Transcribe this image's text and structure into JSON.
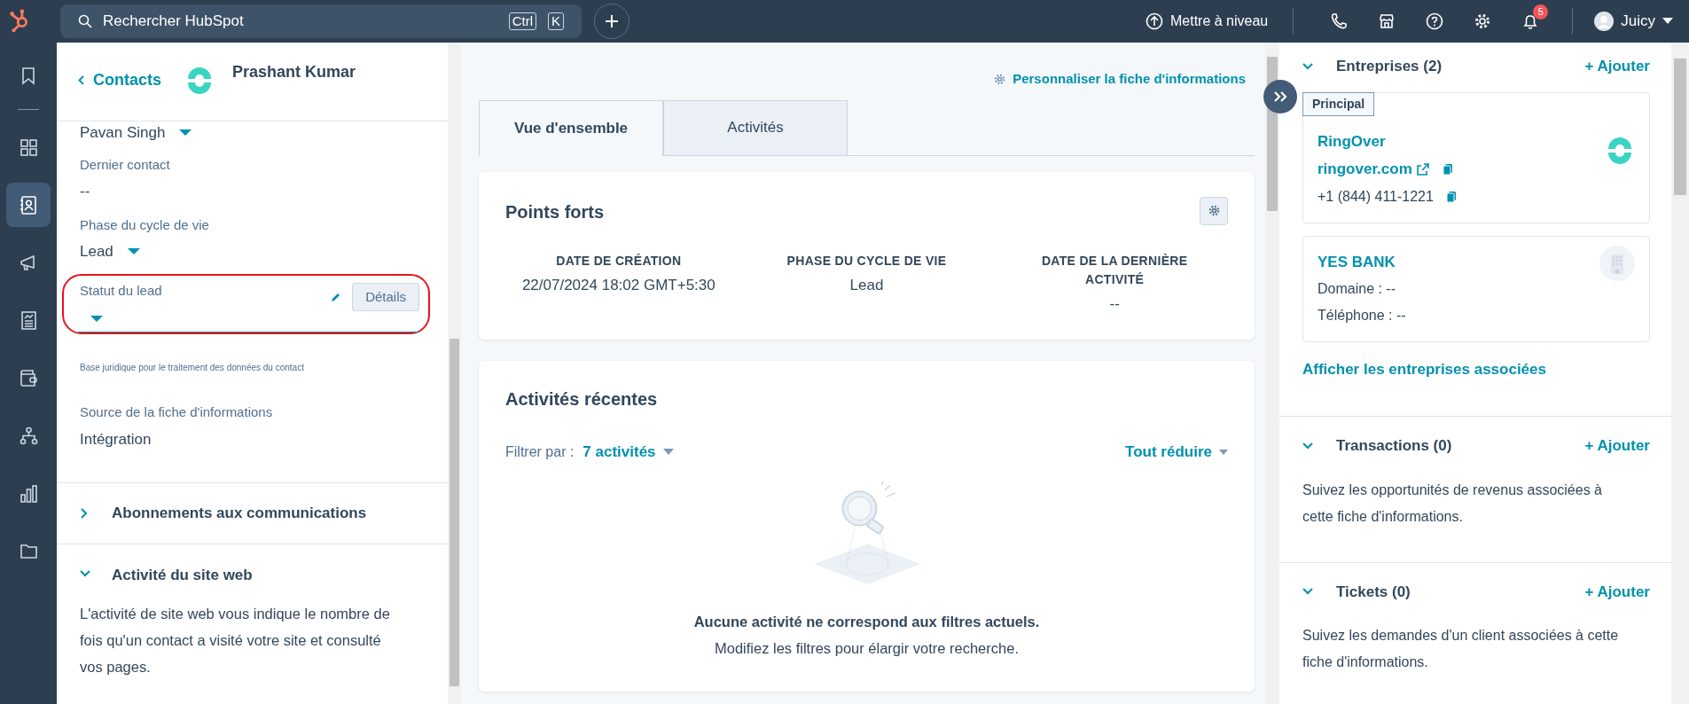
{
  "top_bar": {
    "search": {
      "placeholder": "Rechercher HubSpot",
      "keys": [
        "Ctrl",
        "K"
      ]
    },
    "upgrade": "Mettre à niveau",
    "notifications": "5",
    "user": "Juicy"
  },
  "nav": [
    {
      "kind": "bookmark",
      "selected": false
    },
    {
      "kind": "grid",
      "selected": false
    },
    {
      "kind": "contacts",
      "selected": true
    },
    {
      "kind": "megaphone",
      "selected": false
    },
    {
      "kind": "document",
      "selected": false
    },
    {
      "kind": "wallet",
      "selected": false
    },
    {
      "kind": "network",
      "selected": false
    },
    {
      "kind": "chart",
      "selected": false
    },
    {
      "kind": "folder",
      "selected": false
    }
  ],
  "left_panel": {
    "back": "Contacts",
    "contact_name": "Prashant Kumar",
    "fields": [
      {
        "kind": "dropdown",
        "value": "Pavan Singh"
      },
      {
        "kind": "text",
        "label": "Dernier contact",
        "value": "--"
      },
      {
        "kind": "dropdown",
        "label": "Phase du cycle de vie",
        "value": "Lead"
      },
      {
        "kind": "edit",
        "label": "Statut du lead",
        "button": "Détails",
        "highlighted": true
      },
      {
        "kind": "note",
        "value": "Base juridique pour le traitement des données du contact"
      },
      {
        "kind": "text",
        "label": "Source de la fiche d'informations",
        "value": "Intégration"
      }
    ],
    "sections": [
      {
        "title": "Abonnements aux communications",
        "expanded": false
      },
      {
        "title": "Activité du site web",
        "expanded": true,
        "body": "L'activité de site web vous indique le nombre de fois qu'un contact a visité votre site et consulté vos pages."
      }
    ]
  },
  "middle": {
    "customize": "Personnaliser la fiche d'informations",
    "tabs": [
      {
        "label": "Vue d'ensemble",
        "selected": true
      },
      {
        "label": "Activités",
        "selected": false
      }
    ],
    "highlights": {
      "title": "Points forts",
      "items": [
        {
          "label": "DATE DE CRÉATION",
          "value": "22/07/2024 18:02 GMT+5:30"
        },
        {
          "label": "PHASE DU CYCLE DE VIE",
          "value": "Lead"
        },
        {
          "label": "DATE DE LA DERNIÈRE ACTIVITÉ",
          "value": "--"
        }
      ]
    },
    "recent": {
      "title": "Activités récentes",
      "filter_label": "Filtrer par :",
      "filter_value": "7 activités",
      "collapse": "Tout réduire",
      "empty_title": "Aucune activité ne correspond aux filtres actuels.",
      "empty_text": "Modifiez les filtres pour élargir votre recherche."
    }
  },
  "right_panel": {
    "sections": [
      {
        "title": "Entreprises (2)",
        "add": "+ Ajouter",
        "expanded": true,
        "companies": [
          {
            "kind": "ring",
            "badge": "Principal",
            "name": "RingOver",
            "domain": "ringover.com",
            "phone": "+1 (844) 411-1221"
          },
          {
            "kind": "building",
            "name": "YES BANK",
            "lines": [
              "Domaine : --",
              "Téléphone : --"
            ]
          }
        ],
        "link": "Afficher les entreprises associées"
      },
      {
        "title": "Transactions (0)",
        "add": "+ Ajouter",
        "expanded": true,
        "text": "Suivez les opportunités de revenus associées à cette fiche d'informations."
      },
      {
        "title": "Tickets (0)",
        "add": "+ Ajouter",
        "expanded": true,
        "text": "Suivez les demandes d'un client associées à cette fiche d'informations."
      }
    ]
  }
}
